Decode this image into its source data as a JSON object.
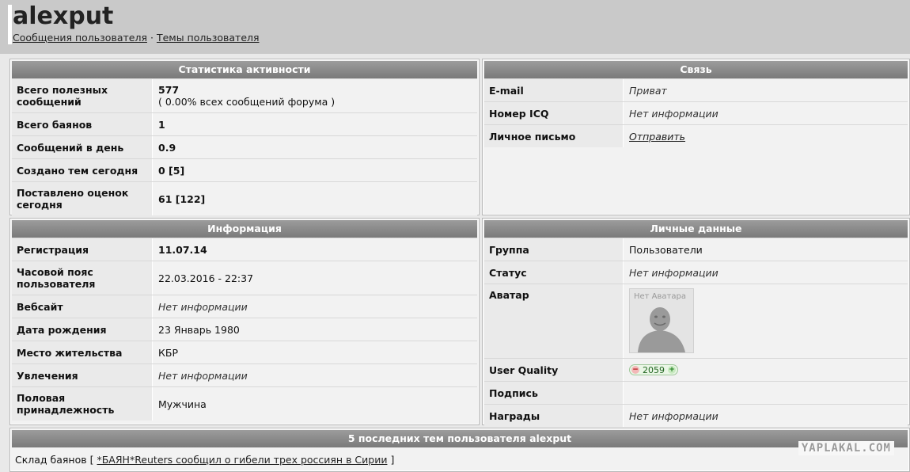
{
  "header": {
    "username": "alexput",
    "links": [
      "Сообщения пользователя",
      "Темы пользователя"
    ],
    "separator": "·"
  },
  "activity": {
    "title": "Статистика активности",
    "rows": [
      {
        "label": "Всего полезных сообщений",
        "value": "577",
        "note": "( 0.00% всех сообщений форума )"
      },
      {
        "label": "Всего баянов",
        "value": "1"
      },
      {
        "label": "Сообщений в день",
        "value": "0.9"
      },
      {
        "label": "Создано тем сегодня",
        "value": "0 [5]"
      },
      {
        "label": "Поставлено оценок сегодня",
        "value": "61 [122]"
      }
    ]
  },
  "contact": {
    "title": "Связь",
    "rows": [
      {
        "label": "E-mail",
        "value": "Приват"
      },
      {
        "label": "Номер ICQ",
        "value": "Нет информации"
      },
      {
        "label": "Личное письмо",
        "value": "Отправить"
      }
    ]
  },
  "info": {
    "title": "Информация",
    "rows": [
      {
        "label": "Регистрация",
        "value": "11.07.14"
      },
      {
        "label": "Часовой пояс пользователя",
        "value": "22.03.2016 - 22:37"
      },
      {
        "label": "Вебсайт",
        "value": "Нет информации"
      },
      {
        "label": "Дата рождения",
        "value": "23 Январь 1980"
      },
      {
        "label": "Место жительства",
        "value": "КБР"
      },
      {
        "label": "Увлечения",
        "value": "Нет информации"
      },
      {
        "label": "Половая принадлежность",
        "value": "Мужчина"
      }
    ]
  },
  "personal": {
    "title": "Личные данные",
    "rows": [
      {
        "label": "Группа",
        "value": "Пользователи"
      },
      {
        "label": "Статус",
        "value": "Нет информации"
      },
      {
        "label": "Аватар",
        "avatar_text": "Нет Аватара"
      },
      {
        "label": "User Quality",
        "value": "2059",
        "minus": "−",
        "plus": "+"
      },
      {
        "label": "Подпись",
        "value": ""
      },
      {
        "label": "Награды",
        "value": "Нет информации"
      }
    ]
  },
  "recent": {
    "title": "5 последних тем пользователя alexput",
    "section": "Склад баянов",
    "open": "[",
    "topic": "*БАЯН*Reuters сообщил о гибели трех россиян в Сирии",
    "close": "]"
  },
  "watermark": "YAPLAKAL.COM",
  "colors": {
    "page_bg": "#e9e9e9",
    "header_bg": "#c9c9c9",
    "panel_title_bg": "#8a8a8a",
    "panel_bg": "#f2f2f2"
  }
}
